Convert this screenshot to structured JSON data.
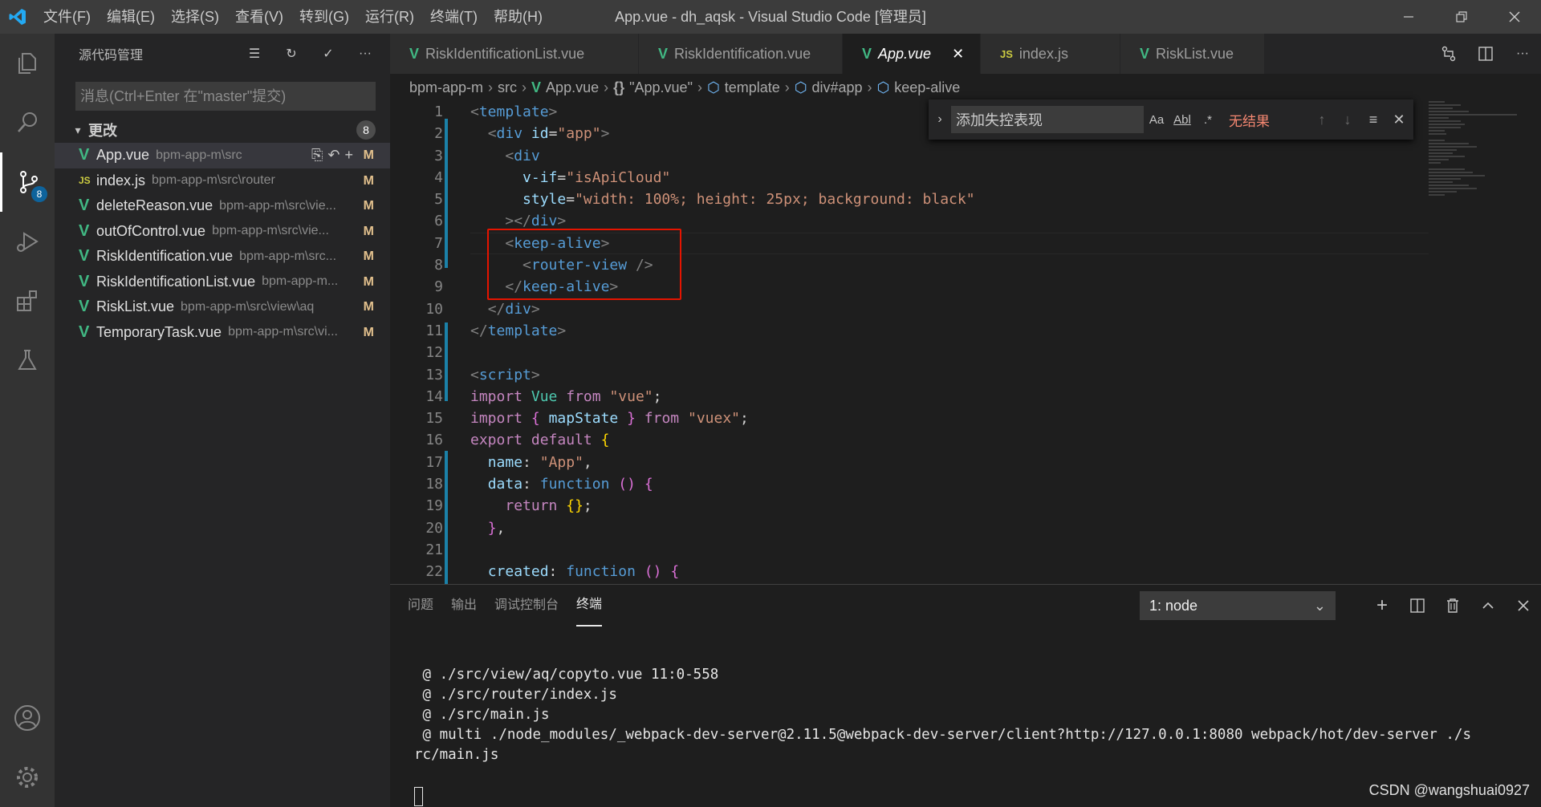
{
  "window": {
    "title": "App.vue - dh_aqsk - Visual Studio Code [管理员]",
    "menu": [
      "文件(F)",
      "编辑(E)",
      "选择(S)",
      "查看(V)",
      "转到(G)",
      "运行(R)",
      "终端(T)",
      "帮助(H)"
    ]
  },
  "activity_bar": {
    "items": [
      "files-icon",
      "search-icon",
      "source-control-icon",
      "run-debug-icon",
      "extensions-icon",
      "testing-icon"
    ],
    "scm_badge": "8",
    "bottom": [
      "account-icon",
      "settings-gear-icon"
    ]
  },
  "sidebar": {
    "title": "源代码管理",
    "message_placeholder": "消息(Ctrl+Enter 在\"master\"提交)",
    "changes_label": "更改",
    "changes_count": "8",
    "files": [
      {
        "icon": "V",
        "type": "vue",
        "name": "App.vue",
        "path": "bpm-app-m\\src",
        "status": "M"
      },
      {
        "icon": "JS",
        "type": "js",
        "name": "index.js",
        "path": "bpm-app-m\\src\\router",
        "status": "M"
      },
      {
        "icon": "V",
        "type": "vue",
        "name": "deleteReason.vue",
        "path": "bpm-app-m\\src\\vie...",
        "status": "M"
      },
      {
        "icon": "V",
        "type": "vue",
        "name": "outOfControl.vue",
        "path": "bpm-app-m\\src\\vie...",
        "status": "M"
      },
      {
        "icon": "V",
        "type": "vue",
        "name": "RiskIdentification.vue",
        "path": "bpm-app-m\\src...",
        "status": "M"
      },
      {
        "icon": "V",
        "type": "vue",
        "name": "RiskIdentificationList.vue",
        "path": "bpm-app-m...",
        "status": "M"
      },
      {
        "icon": "V",
        "type": "vue",
        "name": "RiskList.vue",
        "path": "bpm-app-m\\src\\view\\aq",
        "status": "M"
      },
      {
        "icon": "V",
        "type": "vue",
        "name": "TemporaryTask.vue",
        "path": "bpm-app-m\\src\\vi...",
        "status": "M"
      }
    ]
  },
  "tabs": [
    {
      "icon": "V",
      "type": "vue",
      "label": "RiskIdentificationList.vue",
      "active": false
    },
    {
      "icon": "V",
      "type": "vue",
      "label": "RiskIdentification.vue",
      "active": false
    },
    {
      "icon": "V",
      "type": "vue",
      "label": "App.vue",
      "active": true
    },
    {
      "icon": "JS",
      "type": "js",
      "label": "index.js",
      "active": false
    },
    {
      "icon": "V",
      "type": "vue",
      "label": "RiskList.vue",
      "active": false
    }
  ],
  "breadcrumb": [
    "bpm-app-m",
    "src",
    "App.vue",
    "\"App.vue\"",
    "template",
    "div#app",
    "keep-alive"
  ],
  "find": {
    "value": "添加失控表现",
    "options": [
      "Aa",
      "Abl",
      ".*"
    ],
    "result": "无结果"
  },
  "code_lines": [
    [
      [
        "br",
        "<"
      ],
      [
        "tag",
        "template"
      ],
      [
        "br",
        ">"
      ]
    ],
    [
      [
        "ident",
        "  "
      ],
      [
        "br",
        "<"
      ],
      [
        "tag",
        "div"
      ],
      [
        "ident",
        " "
      ],
      [
        "attr",
        "id"
      ],
      [
        "ident",
        "="
      ],
      [
        "str",
        "\"app\""
      ],
      [
        "br",
        ">"
      ]
    ],
    [
      [
        "ident",
        "    "
      ],
      [
        "br",
        "<"
      ],
      [
        "tag",
        "div"
      ]
    ],
    [
      [
        "ident",
        "      "
      ],
      [
        "attr",
        "v-if"
      ],
      [
        "ident",
        "="
      ],
      [
        "str",
        "\"isApiCloud\""
      ]
    ],
    [
      [
        "ident",
        "      "
      ],
      [
        "attr",
        "style"
      ],
      [
        "ident",
        "="
      ],
      [
        "str",
        "\"width: 100%; height: 25px; background: black\""
      ]
    ],
    [
      [
        "ident",
        "    "
      ],
      [
        "br",
        "></"
      ],
      [
        "tag",
        "div"
      ],
      [
        "br",
        ">"
      ]
    ],
    [
      [
        "ident",
        "    "
      ],
      [
        "br",
        "<"
      ],
      [
        "tag",
        "keep-alive"
      ],
      [
        "br",
        ">"
      ]
    ],
    [
      [
        "ident",
        "      "
      ],
      [
        "br",
        "<"
      ],
      [
        "tag",
        "router-view"
      ],
      [
        "ident",
        " "
      ],
      [
        "br",
        "/>"
      ]
    ],
    [
      [
        "ident",
        "    "
      ],
      [
        "br",
        "</"
      ],
      [
        "tag",
        "keep-alive"
      ],
      [
        "br",
        ">"
      ]
    ],
    [
      [
        "ident",
        "  "
      ],
      [
        "br",
        "</"
      ],
      [
        "tag",
        "div"
      ],
      [
        "br",
        ">"
      ]
    ],
    [
      [
        "br",
        "</"
      ],
      [
        "tag",
        "template"
      ],
      [
        "br",
        ">"
      ]
    ],
    [],
    [
      [
        "br",
        "<"
      ],
      [
        "tag",
        "script"
      ],
      [
        "br",
        ">"
      ]
    ],
    [
      [
        "kw",
        "import"
      ],
      [
        "ident",
        " "
      ],
      [
        "cls",
        "Vue"
      ],
      [
        "ident",
        " "
      ],
      [
        "kw",
        "from"
      ],
      [
        "ident",
        " "
      ],
      [
        "str",
        "\"vue\""
      ],
      [
        "ident",
        ";"
      ]
    ],
    [
      [
        "kw",
        "import"
      ],
      [
        "ident",
        " "
      ],
      [
        "pb",
        "{"
      ],
      [
        "ident",
        " "
      ],
      [
        "prop",
        "mapState"
      ],
      [
        "ident",
        " "
      ],
      [
        "pb",
        "}"
      ],
      [
        "ident",
        " "
      ],
      [
        "kw",
        "from"
      ],
      [
        "ident",
        " "
      ],
      [
        "str",
        "\"vuex\""
      ],
      [
        "ident",
        ";"
      ]
    ],
    [
      [
        "kw",
        "export"
      ],
      [
        "ident",
        " "
      ],
      [
        "kw",
        "default"
      ],
      [
        "ident",
        " "
      ],
      [
        "yb",
        "{"
      ]
    ],
    [
      [
        "ident",
        "  "
      ],
      [
        "prop",
        "name"
      ],
      [
        "ident",
        ": "
      ],
      [
        "str",
        "\"App\""
      ],
      [
        "ident",
        ","
      ]
    ],
    [
      [
        "ident",
        "  "
      ],
      [
        "prop",
        "data"
      ],
      [
        "ident",
        ": "
      ],
      [
        "fn",
        "function"
      ],
      [
        "ident",
        " "
      ],
      [
        "pb",
        "()"
      ],
      [
        "ident",
        " "
      ],
      [
        "pb",
        "{"
      ]
    ],
    [
      [
        "ident",
        "    "
      ],
      [
        "kw",
        "return"
      ],
      [
        "ident",
        " "
      ],
      [
        "yb",
        "{}"
      ],
      [
        "ident",
        ";"
      ]
    ],
    [
      [
        "ident",
        "  "
      ],
      [
        "pb",
        "}"
      ],
      [
        "ident",
        ","
      ]
    ],
    [],
    [
      [
        "ident",
        "  "
      ],
      [
        "prop",
        "created"
      ],
      [
        "ident",
        ": "
      ],
      [
        "fn",
        "function"
      ],
      [
        "ident",
        " "
      ],
      [
        "pb",
        "()"
      ],
      [
        "ident",
        " "
      ],
      [
        "pb",
        "{"
      ]
    ]
  ],
  "line_numbers": [
    "1",
    "2",
    "3",
    "4",
    "5",
    "6",
    "7",
    "8",
    "9",
    "10",
    "11",
    "12",
    "13",
    "14",
    "15",
    "16",
    "17",
    "18",
    "19",
    "20",
    "21",
    "22"
  ],
  "panel": {
    "tabs": [
      "问题",
      "输出",
      "调试控制台",
      "终端"
    ],
    "active_tab": "终端",
    "terminal_select": "1: node",
    "terminal_lines": [
      " @ ./src/view/aq/copyto.vue 11:0-558",
      " @ ./src/router/index.js",
      " @ ./src/main.js",
      " @ multi ./node_modules/_webpack-dev-server@2.11.5@webpack-dev-server/client?http://127.0.0.1:8080 webpack/hot/dev-server ./s",
      "rc/main.js"
    ]
  },
  "watermark": "CSDN @wangshuai0927"
}
